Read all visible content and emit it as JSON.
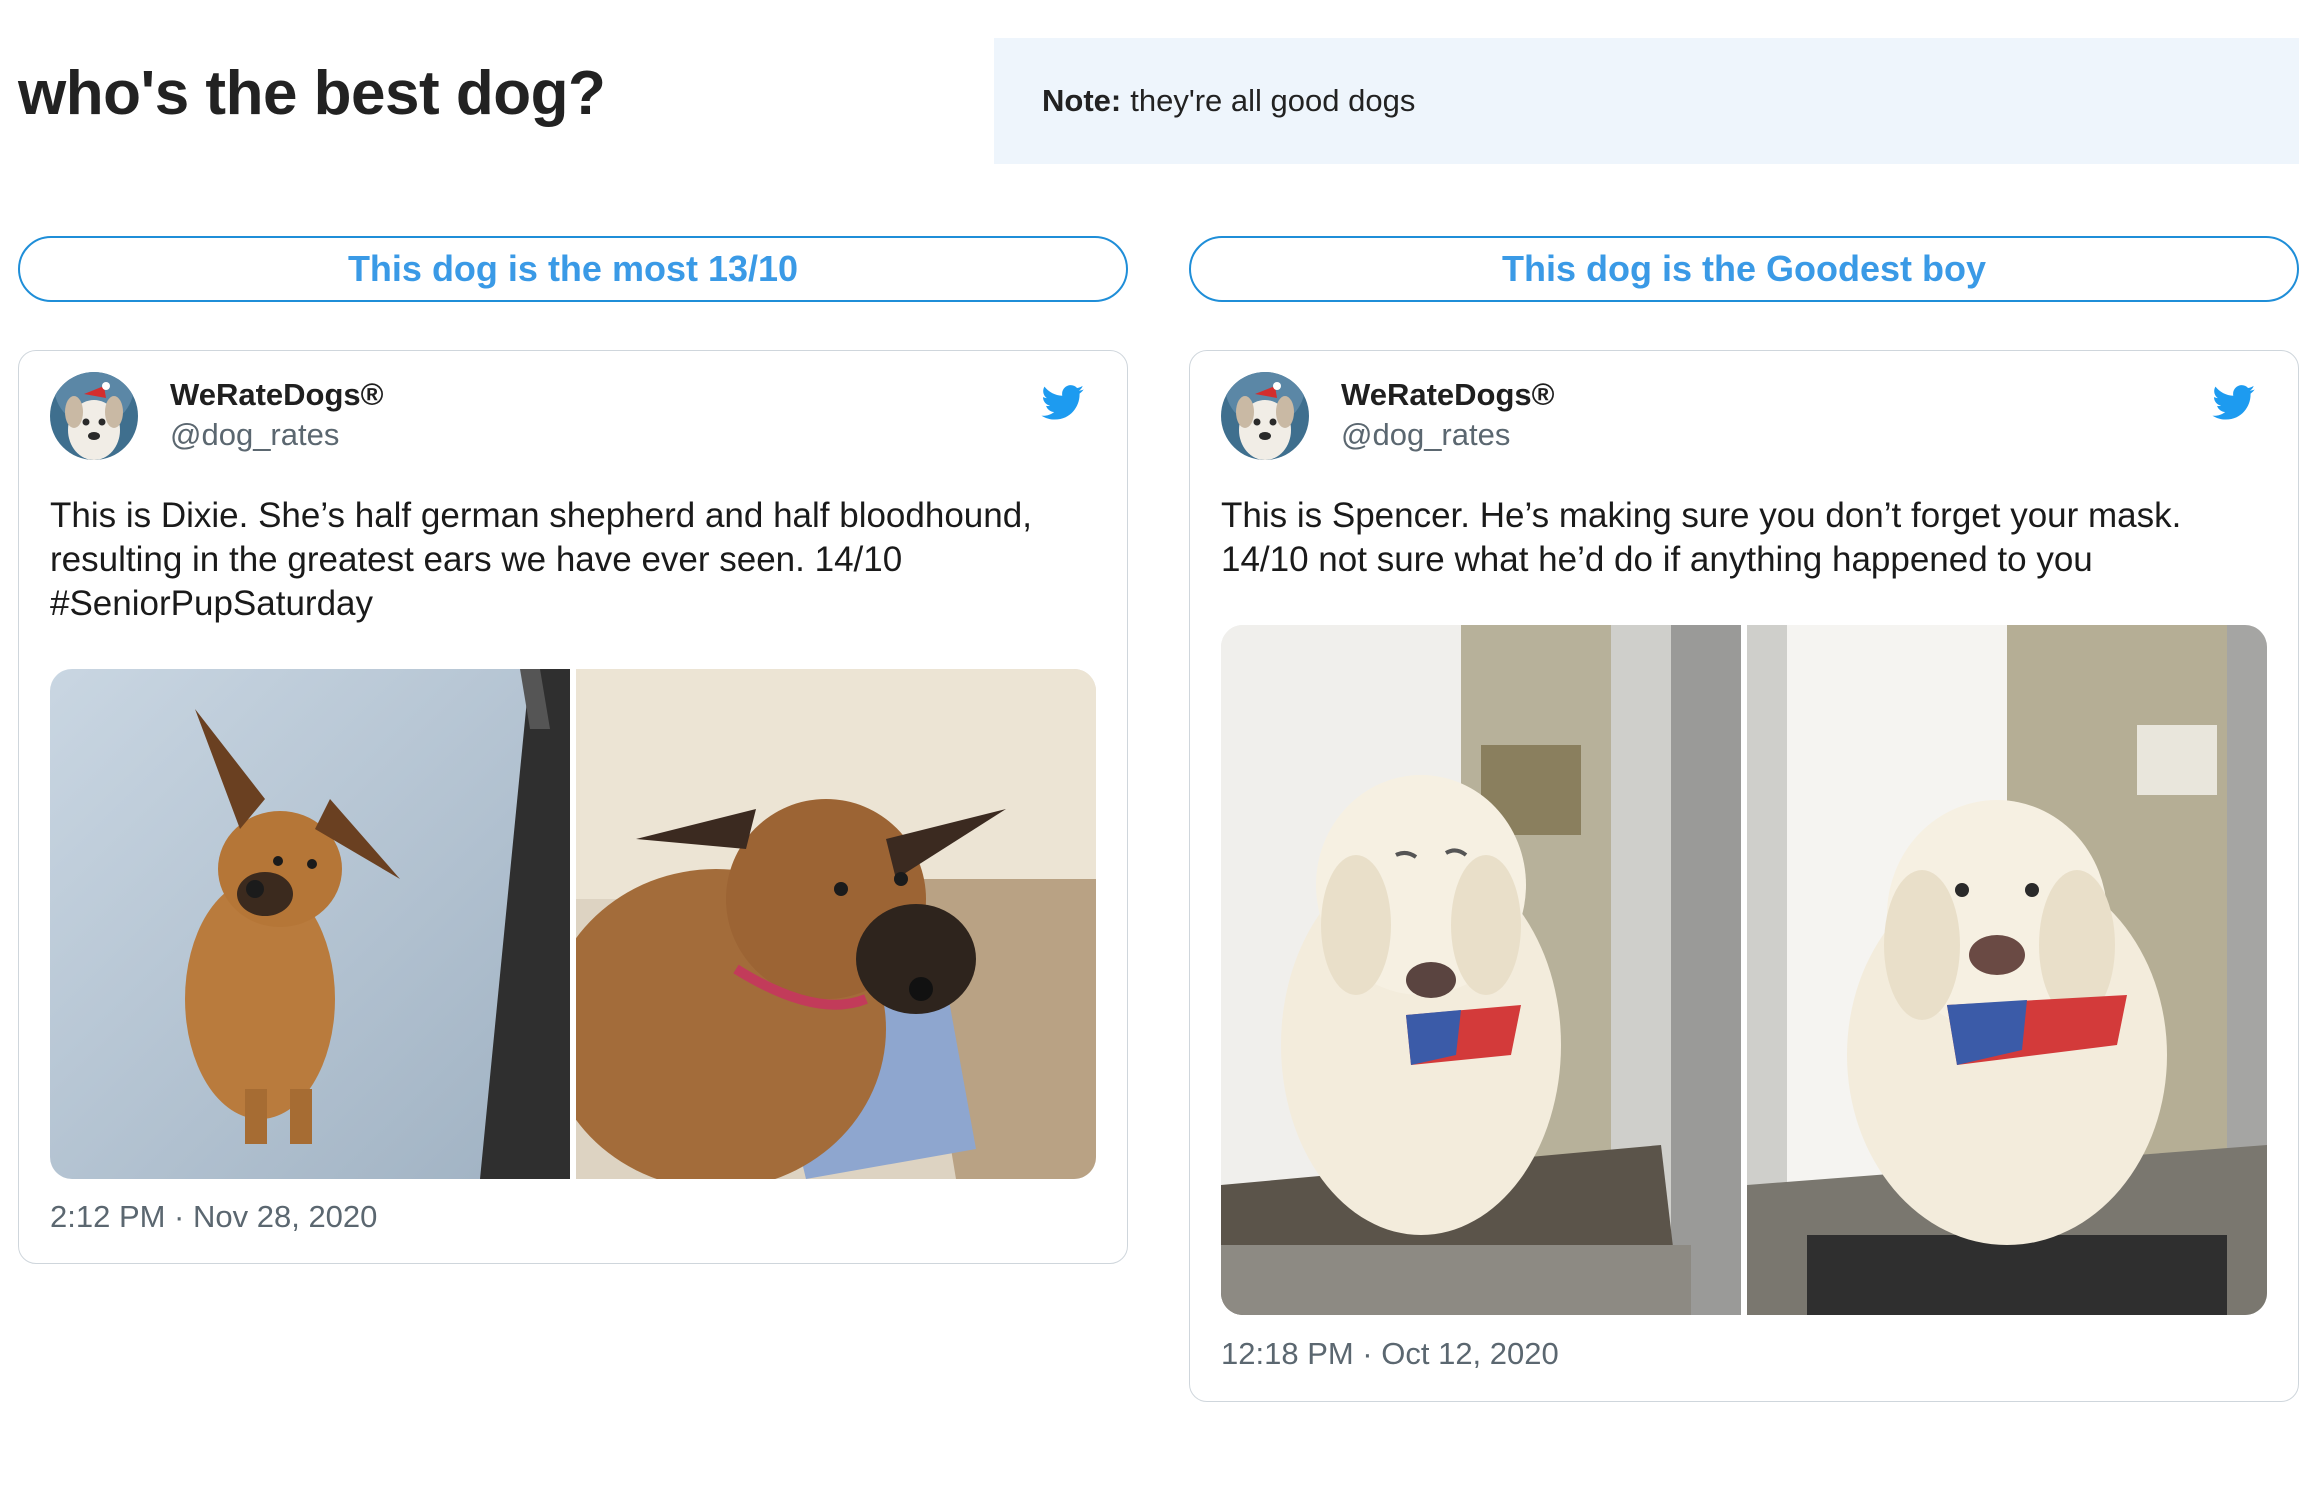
{
  "page": {
    "heading": "who's the best dog?",
    "note_label": "Note:",
    "note_text": "they're all good dogs"
  },
  "vote_buttons": [
    {
      "label": "This dog is the most 13/10"
    },
    {
      "label": "This dog is the Goodest boy"
    }
  ],
  "tweets": [
    {
      "display_name": "WeRateDogs®",
      "handle": "@dog_rates",
      "text": "This is Dixie. She’s half german shepherd and half bloodhound, resulting in the greatest ears we have ever seen. 14/10 #SeniorPupSaturday",
      "timestamp": "2:12 PM · Nov 28, 2020",
      "photos": [
        "dog-photo",
        "dog-photo"
      ]
    },
    {
      "display_name": "WeRateDogs®",
      "handle": "@dog_rates",
      "text": "This is Spencer. He’s making sure you don’t forget your mask. 14/10 not sure what he’d do if anything happened to you",
      "timestamp": "12:18 PM · Oct 12, 2020",
      "photos": [
        "dog-photo",
        "dog-photo"
      ]
    }
  ],
  "colors": {
    "accent": "#1f8ed8",
    "button_text": "#3a9ae6",
    "note_background": "#eef5fc",
    "twitter_blue": "#1d9bf0"
  },
  "icons": [
    "twitter-bird-icon",
    "avatar"
  ]
}
